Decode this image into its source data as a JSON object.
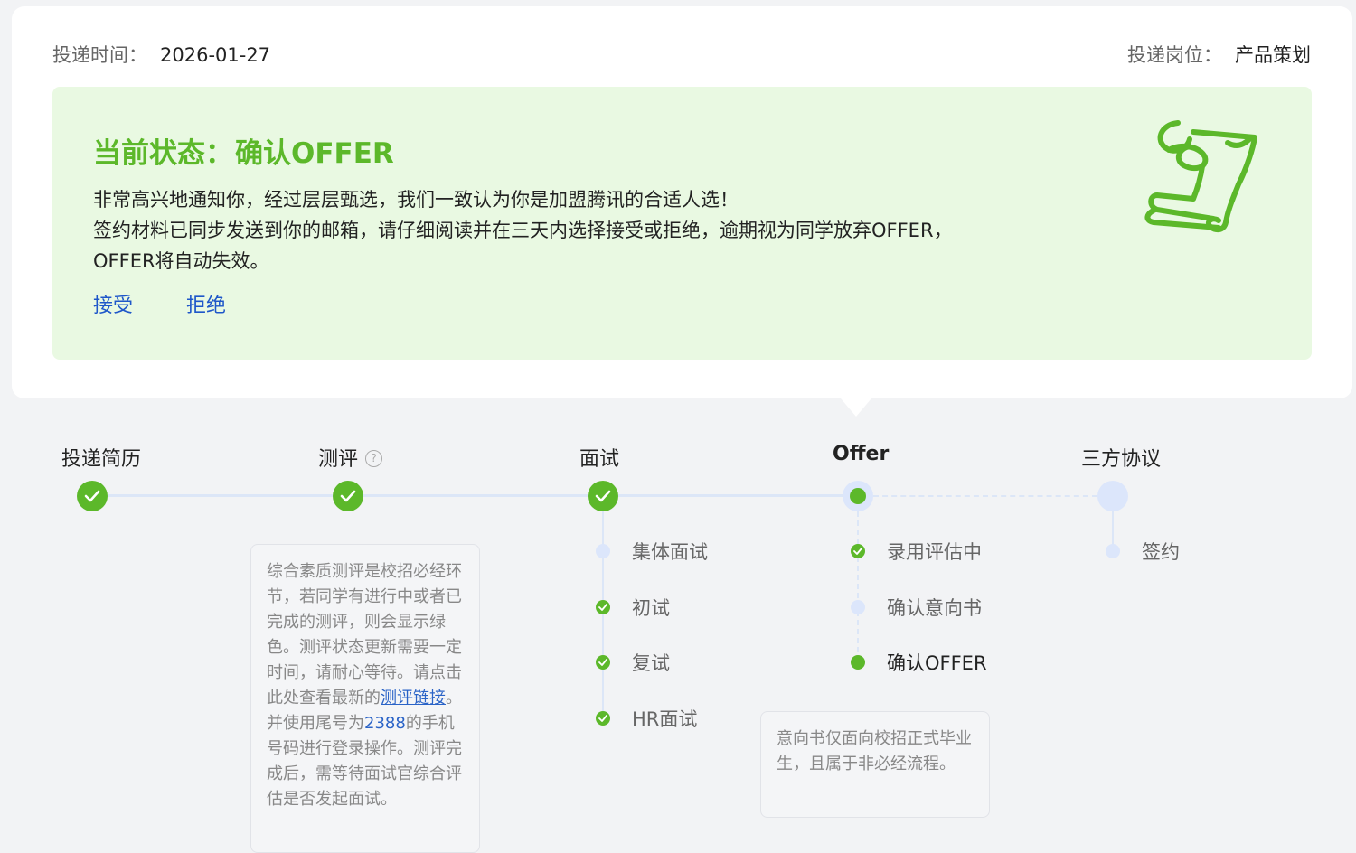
{
  "header": {
    "submit_time_label": "投递时间：",
    "submit_time_value": "2026-01-27",
    "position_label": "投递岗位：",
    "position_value": "产品策划"
  },
  "status": {
    "title_label": "当前状态：",
    "title_value": "确认OFFER",
    "lines": [
      "非常高兴地通知你，经过层层甄选，我们一致认为你是加盟腾讯的合适人选！",
      "签约材料已同步发送到你的邮箱，请仔细阅读并在三天内选择接受或拒绝，逾期视为同学放弃OFFER，",
      "OFFER将自动失效。"
    ],
    "accept_label": "接受",
    "reject_label": "拒绝",
    "icon": "offer-scroll-icon"
  },
  "steps": [
    {
      "title": "投递简历",
      "state": "done"
    },
    {
      "title": "测评",
      "state": "done",
      "help_icon": "question-circle-icon"
    },
    {
      "title": "面试",
      "state": "done"
    },
    {
      "title": "Offer",
      "state": "current"
    },
    {
      "title": "三方协议",
      "state": "todo"
    }
  ],
  "interview_substeps": [
    {
      "label": "集体面试",
      "state": "todo"
    },
    {
      "label": "初试",
      "state": "done"
    },
    {
      "label": "复试",
      "state": "done"
    },
    {
      "label": "HR面试",
      "state": "done"
    }
  ],
  "offer_substeps": [
    {
      "label": "录用评估中",
      "state": "done"
    },
    {
      "label": "确认意向书",
      "state": "todo"
    },
    {
      "label": "确认OFFER",
      "state": "current"
    }
  ],
  "agreement_substeps": [
    {
      "label": "签约",
      "state": "todo"
    }
  ],
  "assessment_tip": {
    "text_before": "综合素质测评是校招必经环节，若同学有进行中或者已完成的测评，则会显示绿色。测评状态更新需要一定时间，请耐心等待。请点击此处查看最新的",
    "link": "测评链接",
    "text_mid": "。并使用尾号为",
    "phone_tail": "2388",
    "text_after": "的手机号码进行登录操作。测评完成后，需等待面试官综合评估是否发起面试。"
  },
  "offer_tip": {
    "text": "意向书仅面向校招正式毕业生，且属于非必经流程。"
  },
  "colors": {
    "green": "#5cb82a",
    "banner_bg": "#e9f9e2",
    "link_blue": "#1e57c9",
    "pending_blue": "#dce6fb"
  }
}
